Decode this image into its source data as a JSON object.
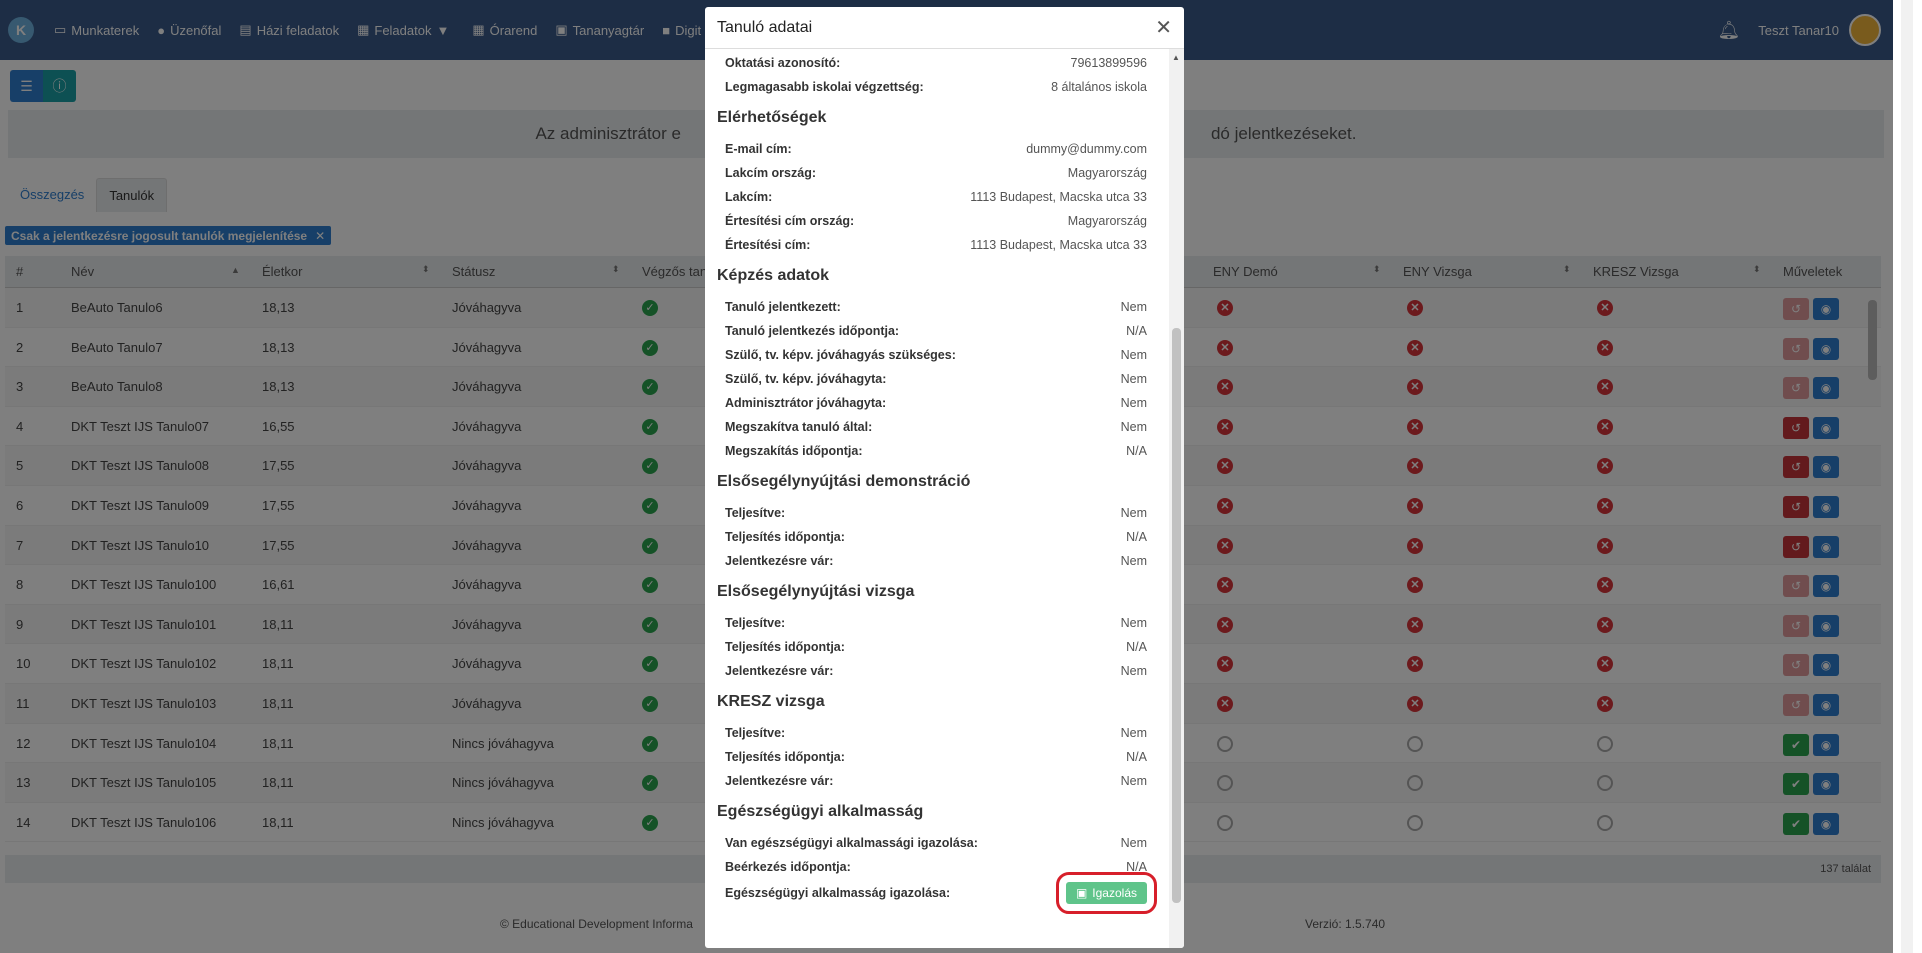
{
  "navbar": {
    "items": [
      {
        "icon": "monitor-icon",
        "label": "Munkaterek"
      },
      {
        "icon": "chat-icon",
        "label": "Üzenőfal"
      },
      {
        "icon": "document-icon",
        "label": "Házi feladatok"
      },
      {
        "icon": "clipboard-icon",
        "label": "Feladatok"
      },
      {
        "icon": "calendar-icon",
        "label": "Órarend"
      },
      {
        "icon": "book-icon",
        "label": "Tananyagtár"
      },
      {
        "icon": "video-icon",
        "label": "Digit"
      }
    ],
    "user": "Teszt Tanar10"
  },
  "banner": {
    "text_left": "Az adminisztrátor e",
    "text_right": "dó jelentkezéseket."
  },
  "tabs": [
    "Összegzés",
    "Tanulók"
  ],
  "filter_chip": {
    "label": "Csak a jelentkezésre jogosult tanulók megjelenítése",
    "close": "✕"
  },
  "table": {
    "headers": {
      "num": "#",
      "name": "Név",
      "age": "Életkor",
      "status": "Státusz",
      "graduate": "Végzős tan",
      "eny_demo": "ENY Demó",
      "eny_exam": "ENY Vizsga",
      "kresz": "KRESZ Vizsga",
      "actions": "Műveletek"
    },
    "rows": [
      {
        "n": "1",
        "name": "BeAuto Tanulo6",
        "age": "18,13",
        "status": "Jóváhagyva",
        "mode": "err",
        "undo": "light"
      },
      {
        "n": "2",
        "name": "BeAuto Tanulo7",
        "age": "18,13",
        "status": "Jóváhagyva",
        "mode": "err",
        "undo": "light"
      },
      {
        "n": "3",
        "name": "BeAuto Tanulo8",
        "age": "18,13",
        "status": "Jóváhagyva",
        "mode": "err",
        "undo": "light"
      },
      {
        "n": "4",
        "name": "DKT Teszt IJS Tanulo07",
        "age": "16,55",
        "status": "Jóváhagyva",
        "mode": "err",
        "undo": "dark"
      },
      {
        "n": "5",
        "name": "DKT Teszt IJS Tanulo08",
        "age": "17,55",
        "status": "Jóváhagyva",
        "mode": "err",
        "undo": "dark"
      },
      {
        "n": "6",
        "name": "DKT Teszt IJS Tanulo09",
        "age": "17,55",
        "status": "Jóváhagyva",
        "mode": "err",
        "undo": "dark"
      },
      {
        "n": "7",
        "name": "DKT Teszt IJS Tanulo10",
        "age": "17,55",
        "status": "Jóváhagyva",
        "mode": "err",
        "undo": "dark"
      },
      {
        "n": "8",
        "name": "DKT Teszt IJS Tanulo100",
        "age": "16,61",
        "status": "Jóváhagyva",
        "mode": "err",
        "undo": "light"
      },
      {
        "n": "9",
        "name": "DKT Teszt IJS Tanulo101",
        "age": "18,11",
        "status": "Jóváhagyva",
        "mode": "err",
        "undo": "light"
      },
      {
        "n": "10",
        "name": "DKT Teszt IJS Tanulo102",
        "age": "18,11",
        "status": "Jóváhagyva",
        "mode": "err",
        "undo": "light"
      },
      {
        "n": "11",
        "name": "DKT Teszt IJS Tanulo103",
        "age": "18,11",
        "status": "Jóváhagyva",
        "mode": "err",
        "undo": "light"
      },
      {
        "n": "12",
        "name": "DKT Teszt IJS Tanulo104",
        "age": "18,11",
        "status": "Nincs jóváhagyva",
        "mode": "ban",
        "undo": "check"
      },
      {
        "n": "13",
        "name": "DKT Teszt IJS Tanulo105",
        "age": "18,11",
        "status": "Nincs jóváhagyva",
        "mode": "ban",
        "undo": "check"
      },
      {
        "n": "14",
        "name": "DKT Teszt IJS Tanulo106",
        "age": "18,11",
        "status": "Nincs jóváhagyva",
        "mode": "ban",
        "undo": "check"
      }
    ],
    "result_count": "137 találat"
  },
  "footer": {
    "left": "© Educational Development Informa",
    "version": "Verzió: 1.5.740"
  },
  "modal": {
    "title": "Tanuló adatai",
    "top_rows": [
      {
        "k": "Oktatási azonosító:",
        "v": "79613899596"
      },
      {
        "k": "Legmagasabb iskolai végzettség:",
        "v": "8 általános iskola"
      }
    ],
    "sections": [
      {
        "title": "Elérhetőségek",
        "rows": [
          {
            "k": "E-mail cím:",
            "v": "dummy@dummy.com"
          },
          {
            "k": "Lakcím ország:",
            "v": "Magyarország"
          },
          {
            "k": "Lakcím:",
            "v": "1113 Budapest, Macska utca 33"
          },
          {
            "k": "Értesítési cím ország:",
            "v": "Magyarország"
          },
          {
            "k": "Értesítési cím:",
            "v": "1113 Budapest, Macska utca 33"
          }
        ]
      },
      {
        "title": "Képzés adatok",
        "rows": [
          {
            "k": "Tanuló jelentkezett:",
            "v": "Nem"
          },
          {
            "k": "Tanuló jelentkezés időpontja:",
            "v": "N/A"
          },
          {
            "k": "Szülő, tv. képv. jóváhagyás szükséges:",
            "v": "Nem"
          },
          {
            "k": "Szülő, tv. képv. jóváhagyta:",
            "v": "Nem"
          },
          {
            "k": "Adminisztrátor jóváhagyta:",
            "v": "Nem"
          },
          {
            "k": "Megszakítva tanuló által:",
            "v": "Nem"
          },
          {
            "k": "Megszakítás időpontja:",
            "v": "N/A"
          }
        ]
      },
      {
        "title": "Elsősegélynyújtási demonstráció",
        "rows": [
          {
            "k": "Teljesítve:",
            "v": "Nem"
          },
          {
            "k": "Teljesítés időpontja:",
            "v": "N/A"
          },
          {
            "k": "Jelentkezésre vár:",
            "v": "Nem"
          }
        ]
      },
      {
        "title": "Elsősegélynyújtási vizsga",
        "rows": [
          {
            "k": "Teljesítve:",
            "v": "Nem"
          },
          {
            "k": "Teljesítés időpontja:",
            "v": "N/A"
          },
          {
            "k": "Jelentkezésre vár:",
            "v": "Nem"
          }
        ]
      },
      {
        "title": "KRESZ vizsga",
        "rows": [
          {
            "k": "Teljesítve:",
            "v": "Nem"
          },
          {
            "k": "Teljesítés időpontja:",
            "v": "N/A"
          },
          {
            "k": "Jelentkezésre vár:",
            "v": "Nem"
          }
        ]
      },
      {
        "title": "Egészségügyi alkalmasság",
        "rows": [
          {
            "k": "Van egészségügyi alkalmassági igazolása:",
            "v": "Nem"
          },
          {
            "k": "Beérkezés időpontja:",
            "v": "N/A"
          }
        ]
      }
    ],
    "last_row_label": "Egészségügyi alkalmasság igazolása:",
    "igazolas_button": "Igazolás"
  },
  "colors": {
    "navbar": "#3a5a8a",
    "primary": "#2e7fd1",
    "success": "#2aa44f",
    "danger": "#d9343a",
    "highlight": "#d71f2a"
  }
}
